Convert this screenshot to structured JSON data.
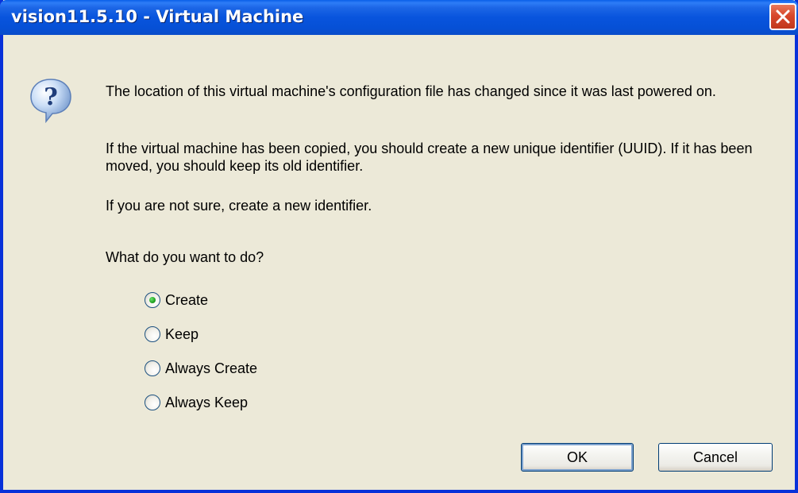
{
  "window": {
    "title": "vision11.5.10 - Virtual Machine"
  },
  "dialog": {
    "icon": "question-icon",
    "messages": [
      "The location of this virtual machine's configuration file has changed since it was last powered on.",
      "If the virtual machine has been copied, you should create a new unique identifier (UUID). If it has been moved, you should keep its old identifier.",
      "If you are not sure, create a new identifier.",
      "What do you want to do?"
    ],
    "options": [
      {
        "label": "Create",
        "selected": true
      },
      {
        "label": "Keep",
        "selected": false
      },
      {
        "label": "Always Create",
        "selected": false
      },
      {
        "label": "Always Keep",
        "selected": false
      }
    ],
    "buttons": {
      "ok": "OK",
      "cancel": "Cancel"
    }
  },
  "colors": {
    "titlebar": "#0854DD",
    "window_face": "#ECE9D8",
    "close_button": "#D8472B",
    "radio_selected": "#21A121"
  }
}
